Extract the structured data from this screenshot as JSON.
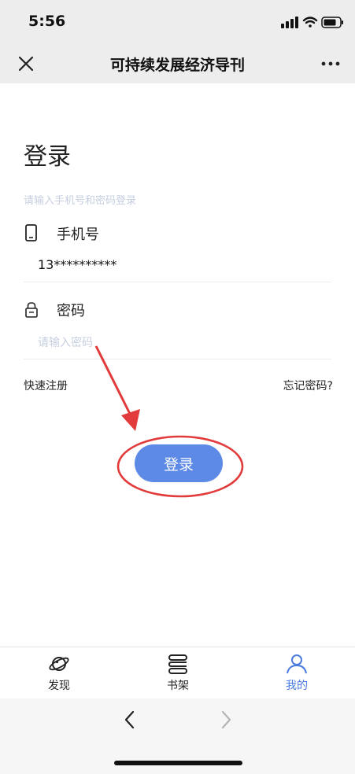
{
  "status_bar": {
    "time": "5:56"
  },
  "nav": {
    "title": "可持续发展经济导刊",
    "close_icon": "close-icon",
    "more_icon": "more-icon"
  },
  "login": {
    "title": "登录",
    "hint": "请输入手机号和密码登录",
    "phone_label": "手机号",
    "phone_value": "13**********",
    "password_label": "密码",
    "password_placeholder": "请输入密码",
    "register_link": "快速注册",
    "forgot_link": "忘记密码?",
    "submit_label": "登录"
  },
  "tabs": [
    {
      "label": "发现",
      "icon": "planet-icon",
      "active": false
    },
    {
      "label": "书架",
      "icon": "bookshelf-icon",
      "active": false
    },
    {
      "label": "我的",
      "icon": "user-icon",
      "active": true
    }
  ],
  "colors": {
    "accent": "#5c8ae6",
    "active_tab": "#4a7be0",
    "annotation": "#e23b3b",
    "placeholder": "#c6cfe0"
  }
}
